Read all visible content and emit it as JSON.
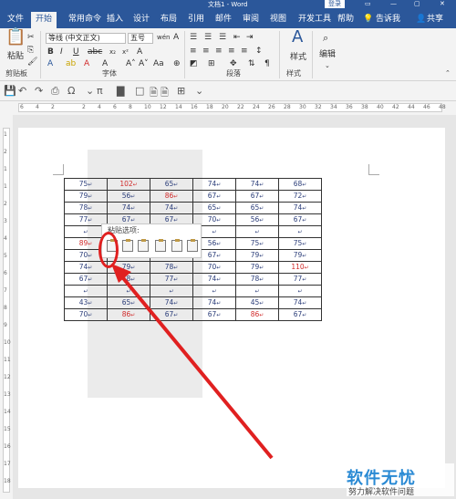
{
  "window": {
    "title": "文档1 - Word",
    "login_label": "登录",
    "controls": [
      "▭",
      "—",
      "▢",
      "✕"
    ]
  },
  "tabs": [
    "文件",
    "开始",
    "常用命令",
    "插入",
    "设计",
    "布局",
    "引用",
    "邮件",
    "审阅",
    "视图",
    "开发工具",
    "帮助"
  ],
  "active_tab": "开始",
  "tell_me": "告诉我",
  "share": "共享",
  "ribbon": {
    "clipboard": {
      "paste_label": "粘贴",
      "group_label": "剪贴板"
    },
    "font": {
      "font_name": "等线 (中文正文)",
      "font_size": "五号",
      "group_label": "字体"
    },
    "paragraph": {
      "group_label": "段落"
    },
    "styles": {
      "label": "样式",
      "group_label": "样式"
    },
    "editing": {
      "label": "编辑"
    }
  },
  "ruler": {
    "ticks": [
      "6",
      "4",
      "2",
      "",
      "2",
      "4",
      "6",
      "8",
      "10",
      "12",
      "14",
      "16",
      "18",
      "20",
      "22",
      "24",
      "26",
      "28",
      "30",
      "32",
      "34",
      "36",
      "38",
      "40",
      "42",
      "44",
      "46",
      "48"
    ]
  },
  "vruler": {
    "ticks": [
      "1",
      "2",
      "1",
      "1",
      "2",
      "3",
      "4",
      "5",
      "6",
      "7",
      "8",
      "9",
      "10",
      "11",
      "12",
      "13",
      "14",
      "15",
      "16",
      "17",
      "18"
    ]
  },
  "table": {
    "rows": [
      [
        "75",
        "102",
        "65",
        "74",
        "74",
        "68"
      ],
      [
        "79",
        "56",
        "86",
        "67",
        "67",
        "72"
      ],
      [
        "78",
        "74",
        "74",
        "65",
        "65",
        "74"
      ],
      [
        "77",
        "67",
        "67",
        "70",
        "56",
        "67"
      ],
      [
        "",
        "",
        "",
        "",
        "",
        ""
      ],
      [
        "89",
        "",
        "",
        "56",
        "75",
        "75"
      ],
      [
        "70",
        "75",
        "79",
        "67",
        "79",
        "79"
      ],
      [
        "74",
        "79",
        "78",
        "70",
        "79",
        "110"
      ],
      [
        "67",
        "78",
        "77",
        "74",
        "78",
        "77"
      ],
      [
        "",
        "",
        "",
        "",
        "",
        ""
      ],
      [
        "43",
        "65",
        "74",
        "74",
        "45",
        "74"
      ],
      [
        "70",
        "86",
        "67",
        "67",
        "86",
        "67"
      ]
    ],
    "red_cells": [
      "0-1",
      "1-2",
      "5-0",
      "7-5",
      "11-1",
      "11-4"
    ]
  },
  "paste_options": {
    "title": "粘贴选项:"
  },
  "watermark": {
    "brand": "软件无忧",
    "slogan": "努力解决软件问题"
  }
}
